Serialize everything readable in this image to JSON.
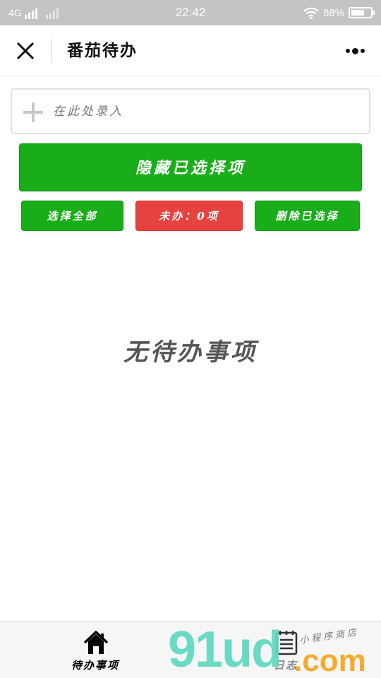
{
  "status_bar": {
    "network": "4G",
    "time": "22:42",
    "battery_percent": "68%",
    "battery_level": 0.68
  },
  "nav": {
    "title": "番茄待办",
    "close_icon": "close-icon",
    "more_icon": "more-dots-icon"
  },
  "input": {
    "placeholder": "在此处录入",
    "value": ""
  },
  "buttons": {
    "hide_selected": "隐藏已选择项",
    "select_all": "选择全部",
    "pending_count": "未办：0项",
    "delete_selected": "删除已选择"
  },
  "empty_state": {
    "text": "无待办事项"
  },
  "tabbar": {
    "tabs": [
      {
        "label": "待办事项",
        "icon": "home-icon",
        "active": true
      },
      {
        "label": "日志",
        "icon": "notepad-icon",
        "active": false
      }
    ]
  },
  "watermark": {
    "main": "91ud",
    "suffix": ".com",
    "tagline": "小程序商店"
  },
  "colors": {
    "primary_green": "#19ad19",
    "danger_red": "#e64340",
    "status_bar_gray": "#c4c4c4"
  }
}
